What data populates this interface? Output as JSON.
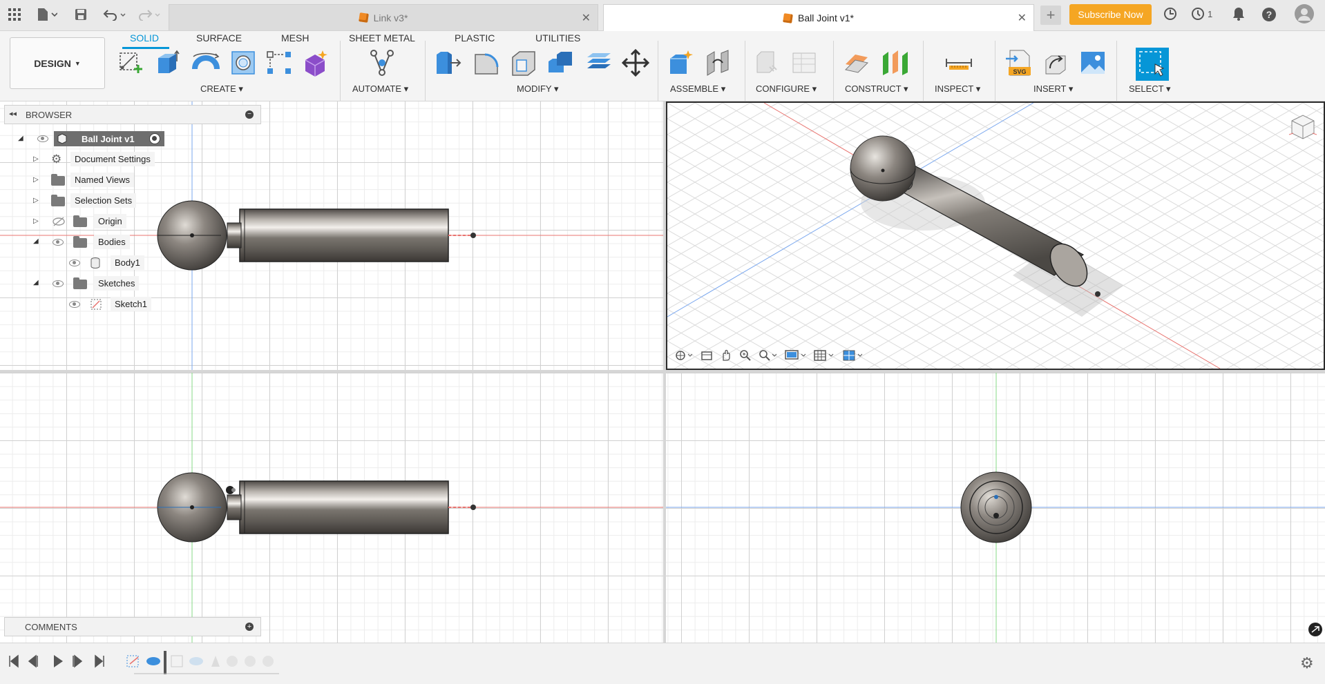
{
  "app": {
    "tabs": [
      {
        "label": "Link v3*",
        "active": false
      },
      {
        "label": "Ball Joint v1*",
        "active": true
      }
    ],
    "subscribe_label": "Subscribe Now",
    "jobs_count": "1"
  },
  "ribbon": {
    "workspace_label": "DESIGN",
    "tabs": [
      "SOLID",
      "SURFACE",
      "MESH",
      "SHEET METAL",
      "PLASTIC",
      "UTILITIES"
    ],
    "active_tab": "SOLID",
    "groups": [
      "CREATE",
      "AUTOMATE",
      "MODIFY",
      "ASSEMBLE",
      "CONFIGURE",
      "CONSTRUCT",
      "INSPECT",
      "INSERT",
      "SELECT"
    ]
  },
  "browser": {
    "title": "BROWSER",
    "root": "Ball Joint v1",
    "items": [
      {
        "label": "Document Settings",
        "icon": "gear-icon"
      },
      {
        "label": "Named Views",
        "icon": "folder-icon"
      },
      {
        "label": "Selection Sets",
        "icon": "folder-icon"
      },
      {
        "label": "Origin",
        "icon": "folder-icon",
        "hidden": true
      },
      {
        "label": "Bodies",
        "icon": "folder-icon"
      },
      {
        "label": "Body1",
        "icon": "body-icon"
      },
      {
        "label": "Sketches",
        "icon": "folder-icon"
      },
      {
        "label": "Sketch1",
        "icon": "sketch-icon"
      }
    ]
  },
  "comments": {
    "title": "COMMENTS"
  },
  "colors": {
    "accent": "#0696d7",
    "subscribe": "#f5a623",
    "x_axis": "#e8736f",
    "y_axis": "#7aa7ee",
    "z_axis": "#86d985",
    "body": "#6f6b66"
  }
}
